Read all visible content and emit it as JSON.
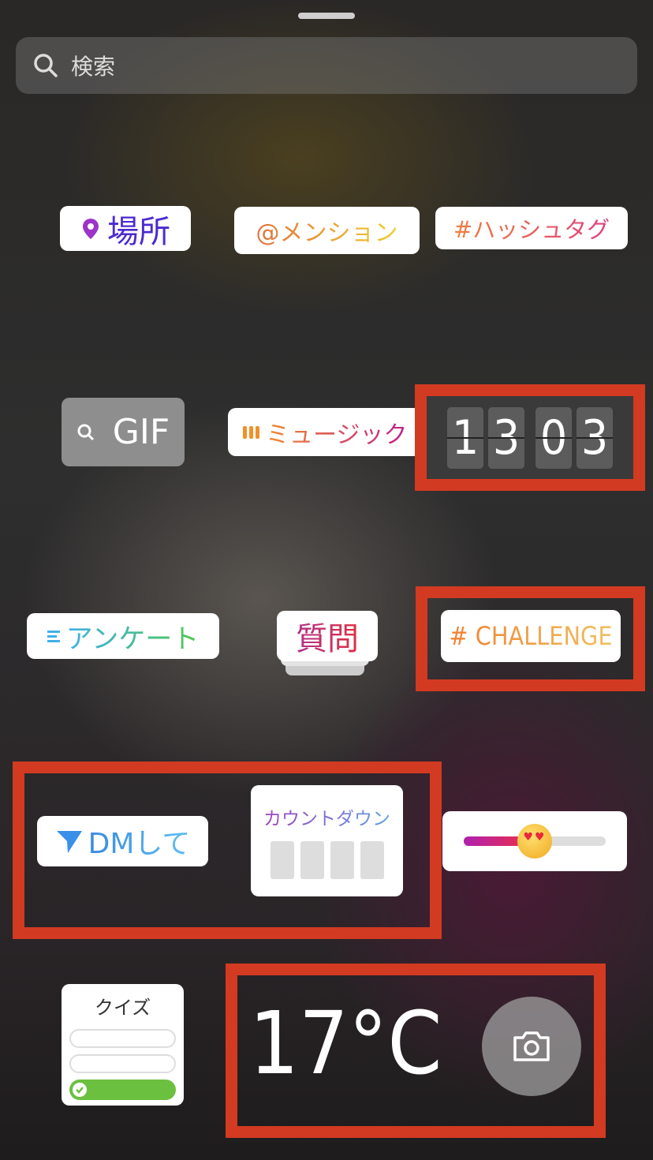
{
  "search": {
    "placeholder": "検索",
    "icon": "search-icon"
  },
  "stickers": {
    "location": {
      "label": "場所",
      "icon": "location-pin-icon",
      "color": "#4b2bd0"
    },
    "mention": {
      "label": "@メンション"
    },
    "hashtag": {
      "label": "#ハッシュタグ"
    },
    "gif": {
      "label": "GIF",
      "icon": "search-icon"
    },
    "music": {
      "label": "ミュージック",
      "icon": "music-bars-icon"
    },
    "clock": {
      "digits": [
        "1",
        "3",
        "0",
        "3"
      ]
    },
    "poll": {
      "label": "アンケート",
      "icon": "list-icon"
    },
    "question": {
      "label": "質問"
    },
    "challenge": {
      "label": "# CHALLENGE"
    },
    "dm": {
      "label": "DMして",
      "icon": "paper-plane-icon"
    },
    "countdown": {
      "label": "カウントダウン"
    },
    "slider": {
      "emoji": "😍",
      "value": 0.5
    },
    "quiz": {
      "label": "クイズ"
    },
    "weather": {
      "label": "17°C"
    },
    "camera": {
      "icon": "camera-icon"
    }
  },
  "colors": {
    "highlight": "#d23a22"
  }
}
